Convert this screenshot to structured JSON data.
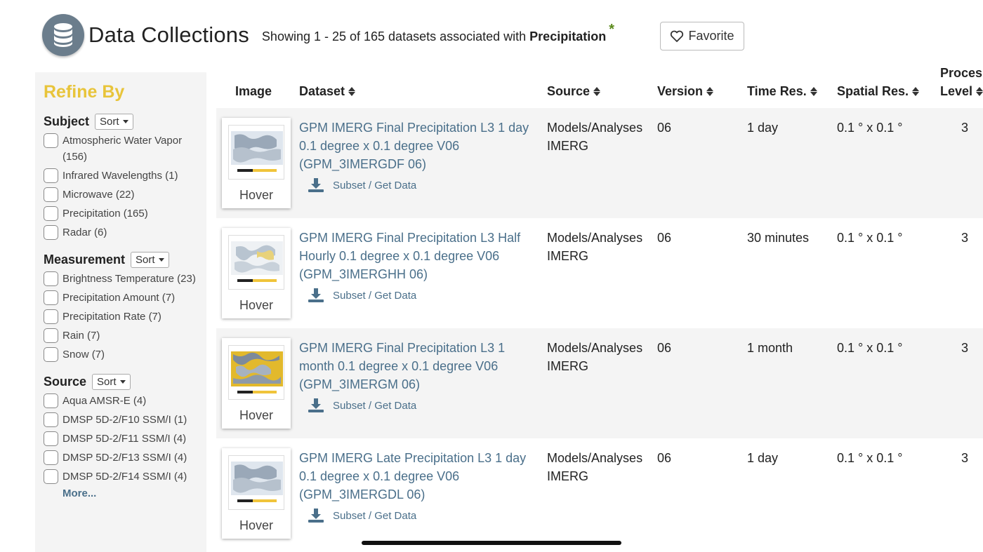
{
  "header": {
    "title": "Data Collections",
    "showing_prefix": "Showing 1 - 25 of 165 datasets associated with",
    "keyword": "Precipitation",
    "asterisk": "*",
    "favorite_label": "Favorite"
  },
  "sidebar": {
    "refine_title": "Refine By",
    "more_label": "More...",
    "sort_label": "Sort",
    "facets": [
      {
        "title": "Subject",
        "items": [
          "Atmospheric Water Vapor (156)",
          "Infrared Wavelengths (1)",
          "Microwave (22)",
          "Precipitation (165)",
          "Radar (6)"
        ]
      },
      {
        "title": "Measurement",
        "items": [
          "Brightness Temperature (23)",
          "Precipitation Amount (7)",
          "Precipitation Rate (7)",
          "Rain (7)",
          "Snow (7)"
        ]
      },
      {
        "title": "Source",
        "items": [
          "Aqua AMSR-E (4)",
          "DMSP 5D-2/F10 SSM/I (1)",
          "DMSP 5D-2/F11 SSM/I (4)",
          "DMSP 5D-2/F13 SSM/I (4)",
          "DMSP 5D-2/F14 SSM/I (4)"
        ]
      }
    ]
  },
  "table": {
    "columns": {
      "image": "Image",
      "dataset": "Dataset",
      "source": "Source",
      "version": "Version",
      "time_res": "Time Res.",
      "spatial_res": "Spatial Res.",
      "proc_level_1": "Proces",
      "proc_level_2": "Level"
    },
    "hover_label": "Hover",
    "subset_label": "Subset / Get Data",
    "rows": [
      {
        "dataset": "GPM IMERG Final Precipitation L3 1 day 0.1 degree x 0.1 degree V06 (GPM_3IMERGDF 06)",
        "source": "Models/Analyses IMERG",
        "version": "06",
        "time_res": "1 day",
        "spatial_res": "0.1 ° x 0.1 °",
        "level": "3"
      },
      {
        "dataset": "GPM IMERG Final Precipitation L3 Half Hourly 0.1 degree x 0.1 degree V06 (GPM_3IMERGHH 06)",
        "source": "Models/Analyses IMERG",
        "version": "06",
        "time_res": "30 minutes",
        "spatial_res": "0.1 ° x 0.1 °",
        "level": "3"
      },
      {
        "dataset": "GPM IMERG Final Precipitation L3 1 month 0.1 degree x 0.1 degree V06 (GPM_3IMERGM 06)",
        "source": "Models/Analyses IMERG",
        "version": "06",
        "time_res": "1 month",
        "spatial_res": "0.1 ° x 0.1 °",
        "level": "3"
      },
      {
        "dataset": "GPM IMERG Late Precipitation L3 1 day 0.1 degree x 0.1 degree V06 (GPM_3IMERGDL 06)",
        "source": "Models/Analyses IMERG",
        "version": "06",
        "time_res": "1 day",
        "spatial_res": "0.1 ° x 0.1 °",
        "level": "3"
      }
    ]
  },
  "colors": {
    "refine_title": "#e8c43a",
    "link": "#4a6f8a",
    "sidebar_bg": "#f4f4f4",
    "asterisk": "#5a8a1a"
  },
  "icons": [
    "database-icon",
    "heart-icon",
    "sort-caret-icon",
    "sort-arrows-icon",
    "download-icon"
  ]
}
